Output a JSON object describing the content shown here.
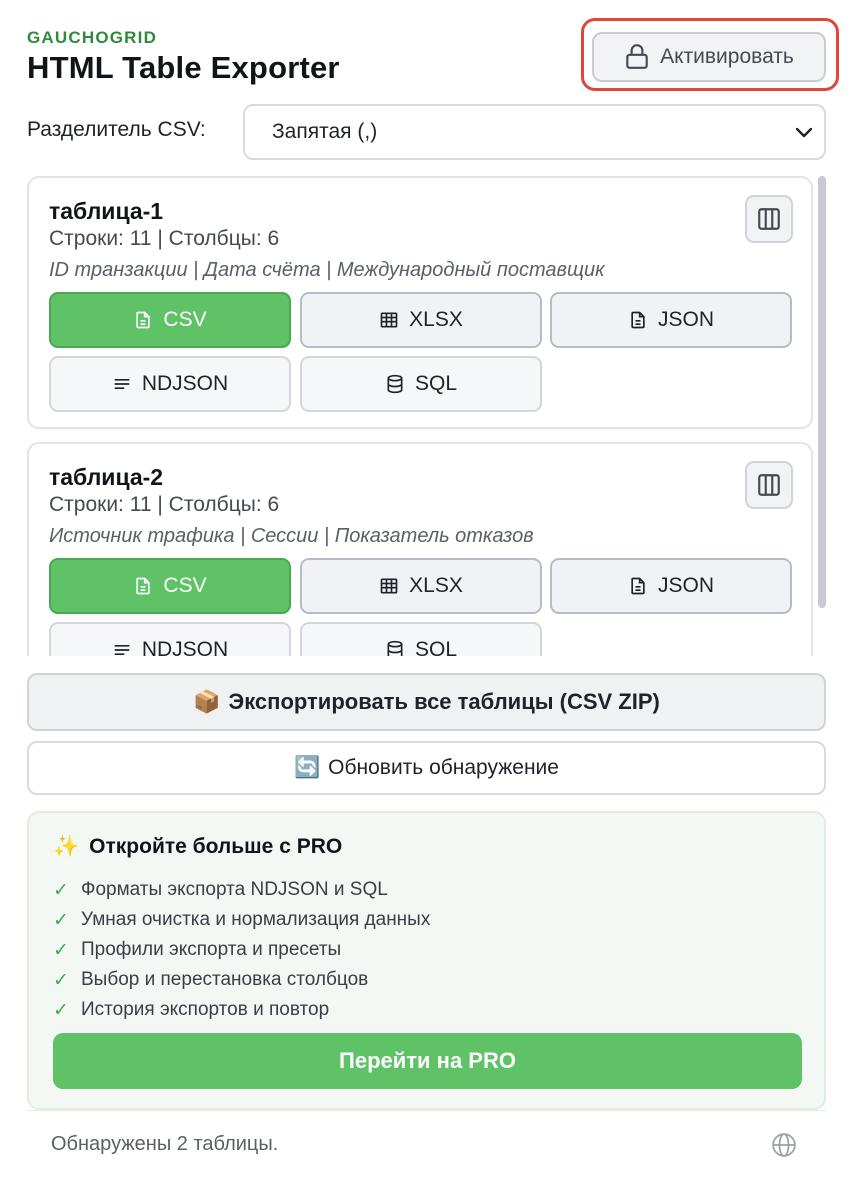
{
  "header": {
    "brand": "GAUCHOGRID",
    "title": "HTML Table Exporter",
    "activate_label": "Активировать",
    "activate_icon": "lock-icon",
    "highlight_color": "#e0463a"
  },
  "separator": {
    "label": "Разделитель CSV:",
    "value": "Запятая (,)"
  },
  "tables": [
    {
      "name": "таблица-1",
      "meta": "Строки: 11 | Столбцы: 6",
      "headers": "ID транзакции | Дата счёта | Международный поставщик"
    },
    {
      "name": "таблица-2",
      "meta": "Строки: 11 | Столбцы: 6",
      "headers": "Источник трафика | Сессии | Показатель отказов"
    }
  ],
  "formats": {
    "csv": "CSV",
    "xlsx": "XLSX",
    "json": "JSON",
    "ndjson": "NDJSON",
    "sql": "SQL"
  },
  "actions": {
    "export_all_icon": "📦",
    "export_all": "Экспортировать все таблицы (CSV ZIP)",
    "refresh_icon": "🔄",
    "refresh": "Обновить обнаружение"
  },
  "pro": {
    "icon": "✨",
    "title": "Откройте больше с PRO",
    "check": "✓",
    "features": [
      "Форматы экспорта NDJSON и SQL",
      "Умная очистка и нормализация данных",
      "Профили экспорта и пресеты",
      "Выбор и перестановка столбцов",
      "История экспортов и повтор"
    ],
    "cta": "Перейти на PRO"
  },
  "status": "Обнаружены 2 таблицы.",
  "colors": {
    "primary_green": "#5fc267",
    "brand_green": "#2f8a3a"
  }
}
